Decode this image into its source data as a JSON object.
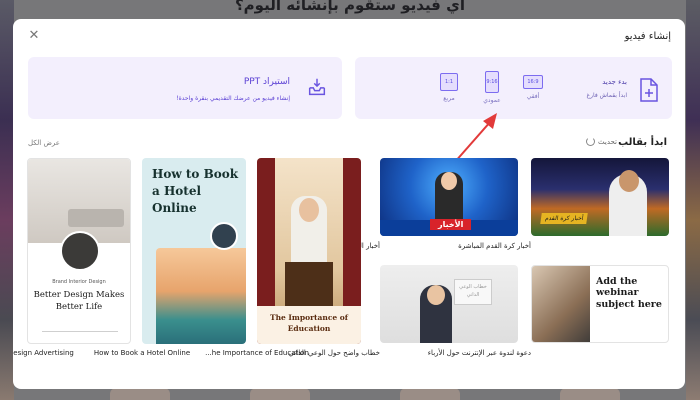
{
  "background": {
    "heading": "أي فيديو ستقوم بإنشائه اليوم؟"
  },
  "modal": {
    "title": "إنشاء فيديو",
    "close_icon": "close-icon"
  },
  "import_ppt": {
    "icon": "inbox-download-icon",
    "title": "استيراد PPT",
    "description": "إنشاء فيديو من عرضك التقديمي بنقرة واحدة!"
  },
  "new_video": {
    "icon": "add-document-icon",
    "title": "بدء جديد",
    "description": "ابدأ بقماش فارغ",
    "ratios": [
      {
        "box": "16:9",
        "label": "أفقي"
      },
      {
        "box": "9:16",
        "label": "عمودي"
      },
      {
        "box": "1:1",
        "label": "مربع"
      }
    ]
  },
  "templates_section": {
    "title": "ابدأ بقالب",
    "refresh_label": "تحديث",
    "view_all": "عرض الكل"
  },
  "templates": [
    {
      "caption": "أخبار كرة القدم المباشرة",
      "overlay": "أخبار كرة القدم"
    },
    {
      "caption": "أخبار الصباح",
      "overlay": "الأخبار"
    },
    {
      "caption": "دعوة لندوة عبر الإنترنت حول الأرباء",
      "overlay": "Add the webinar subject here"
    },
    {
      "caption": "خطاب واضح حول الوعي الذاتي",
      "overlay": "خطاب الوعي الذاتي"
    },
    {
      "caption": "...he Importance of Education",
      "overlay": "The Importance of Education"
    },
    {
      "caption": "How to Book a Hotel Online",
      "overlay": "How to Book a Hotel Online"
    },
    {
      "caption": "Interior Design Advertising",
      "overlay_brand": "Brand Interior Design",
      "overlay": "Better Design Makes Better Life"
    }
  ],
  "colors": {
    "accent": "#5a3fd4",
    "card_bg": "#f3effd",
    "arrow": "#e23a3a"
  }
}
